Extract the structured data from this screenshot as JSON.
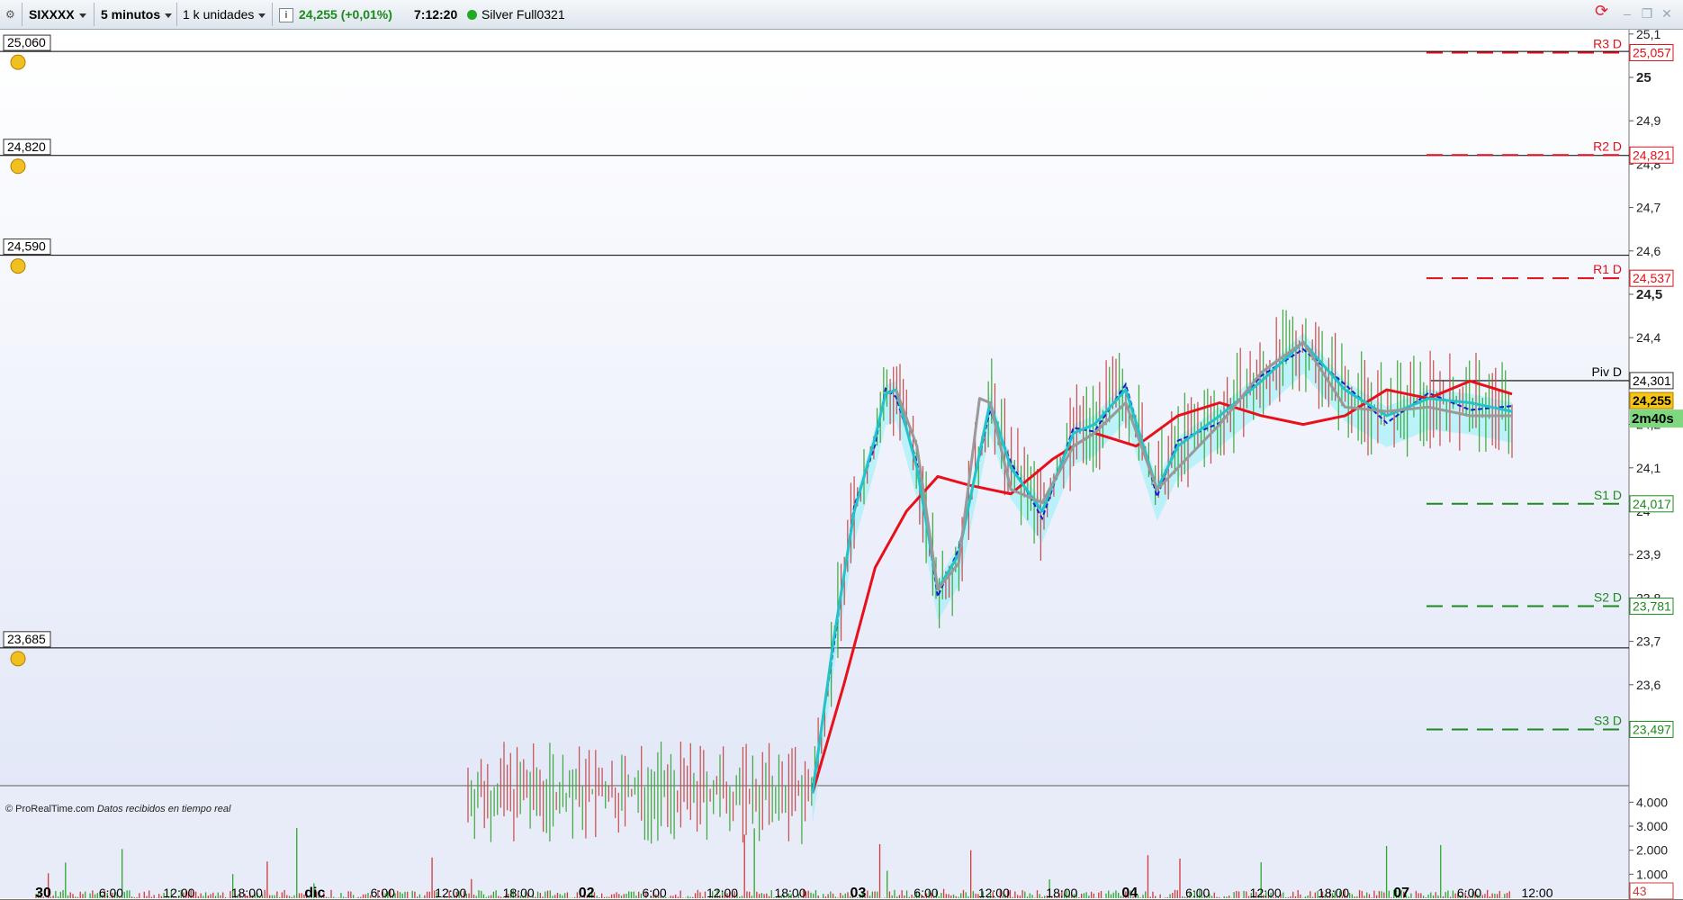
{
  "toolbar": {
    "symbol": "SIXXXX",
    "timeframe": "5 minutos",
    "units": "1 k unidades",
    "info_icon": "i",
    "price": "24,255 (+0,01%)",
    "time": "7:12:20",
    "status_color": "#22aa22",
    "feed": "Silver Full0321",
    "icons": [
      "settings-gear-icon",
      "refresh-icon",
      "minimize-icon",
      "restore-icon",
      "close-icon"
    ]
  },
  "footer": {
    "copyright": "© ProRealTime.com",
    "note": "Datos recibidos en tiempo real"
  },
  "chart_data": {
    "type": "line",
    "ylim": [
      23.4,
      25.1
    ],
    "y_ticks": [
      "25,1",
      "25",
      "24,9",
      "24,8",
      "24,7",
      "24,6",
      "24,5",
      "24,4",
      "24,3",
      "24,2",
      "24,1",
      "24",
      "23,9",
      "23,8",
      "23,7",
      "23,6"
    ],
    "x_labels": [
      "30",
      "6:00",
      "12:00",
      "18:00",
      "dic",
      "6:00",
      "12:00",
      "18:00",
      "02",
      "6:00",
      "12:00",
      "18:00",
      "03",
      "6:00",
      "12:00",
      "18:00",
      "04",
      "6:00",
      "12:00",
      "18:00",
      "07",
      "6:00",
      "12:00"
    ],
    "bold_x_labels": [
      "30",
      "dic",
      "02",
      "03",
      "04",
      "07"
    ],
    "alert_lines": [
      {
        "label": "25,060",
        "value": 25.06
      },
      {
        "label": "24,820",
        "value": 24.82
      },
      {
        "label": "24,590",
        "value": 24.59
      },
      {
        "label": "23,685",
        "value": 23.685
      }
    ],
    "pivot_levels": [
      {
        "name": "R3 D",
        "label": "25,057",
        "value": 25.057,
        "color": "#e0101a"
      },
      {
        "name": "R2 D",
        "label": "24,821",
        "value": 24.821,
        "color": "#e0101a"
      },
      {
        "name": "R1 D",
        "label": "24,537",
        "value": 24.537,
        "color": "#e0101a"
      },
      {
        "name": "Piv D",
        "label": "24,301",
        "value": 24.301,
        "color": "#000000"
      },
      {
        "name": "S1 D",
        "label": "24,017",
        "value": 24.017,
        "color": "#1c8a1c"
      },
      {
        "name": "S2 D",
        "label": "23,781",
        "value": 23.781,
        "color": "#1c8a1c"
      },
      {
        "name": "S3 D",
        "label": "23,497",
        "value": 23.497,
        "color": "#1c8a1c"
      }
    ],
    "current_price": {
      "label": "24,255",
      "value": 24.255
    },
    "countdown": "2m40s",
    "series": [
      {
        "name": "",
        "color": "#e8101a",
        "x": [
          0.33,
          0.36,
          0.39,
          0.42,
          0.45,
          0.48,
          0.52,
          0.56,
          0.6,
          0.64,
          0.68,
          0.72,
          0.76,
          0.8,
          0.84,
          0.88,
          0.92,
          0.96,
          1.0
        ],
        "values": [
          23.35,
          23.6,
          23.87,
          24.0,
          24.08,
          24.06,
          24.04,
          24.12,
          24.18,
          24.15,
          24.22,
          24.25,
          24.22,
          24.2,
          24.22,
          24.28,
          24.26,
          24.3,
          24.27
        ]
      },
      {
        "name": "",
        "color": "#22c4c8",
        "x": [
          0.33,
          0.35,
          0.37,
          0.39,
          0.4,
          0.41,
          0.43,
          0.45,
          0.47,
          0.5,
          0.52,
          0.55,
          0.58,
          0.6,
          0.63,
          0.66,
          0.68,
          0.72,
          0.76,
          0.8,
          0.84,
          0.88,
          0.92,
          0.96,
          1.0
        ],
        "values": [
          23.35,
          23.7,
          24.0,
          24.17,
          24.27,
          24.28,
          24.1,
          23.82,
          23.9,
          24.25,
          24.1,
          24.0,
          24.18,
          24.2,
          24.28,
          24.05,
          24.15,
          24.22,
          24.3,
          24.39,
          24.28,
          24.22,
          24.26,
          24.25,
          24.23
        ]
      },
      {
        "name": "",
        "color": "#999999",
        "x": [
          0.41,
          0.43,
          0.45,
          0.47,
          0.49,
          0.5,
          0.52,
          0.55,
          0.58,
          0.6,
          0.63,
          0.66,
          0.68,
          0.72,
          0.76,
          0.8,
          0.84,
          0.88,
          0.92,
          0.96,
          1.0
        ],
        "values": [
          24.28,
          24.15,
          23.82,
          23.88,
          24.26,
          24.25,
          24.05,
          24.02,
          24.15,
          24.18,
          24.25,
          24.05,
          24.1,
          24.2,
          24.32,
          24.39,
          24.24,
          24.23,
          24.24,
          24.22,
          24.22
        ]
      }
    ],
    "volume": {
      "ticks": [
        "4.000",
        "3.000",
        "2.000",
        "1.000"
      ],
      "last": "43",
      "ylim": [
        0,
        4500
      ]
    }
  }
}
